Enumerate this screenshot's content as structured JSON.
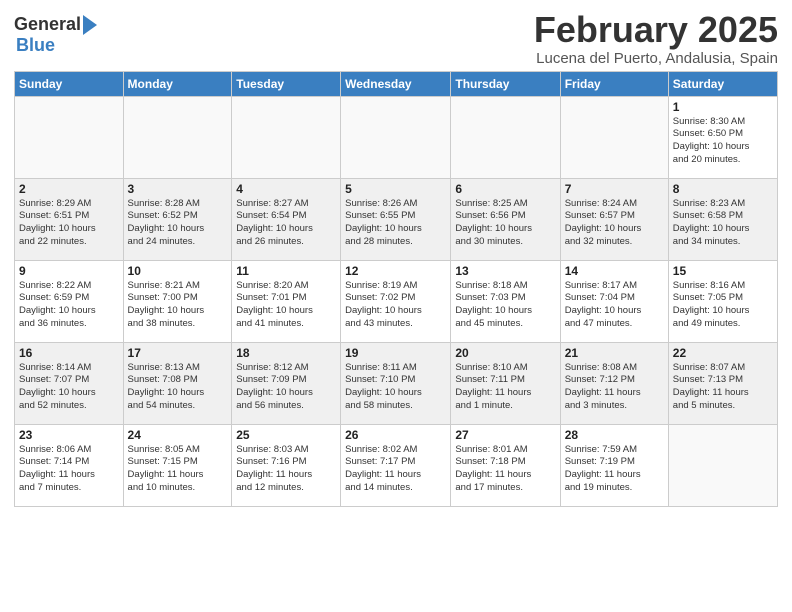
{
  "logo": {
    "general": "General",
    "blue": "Blue"
  },
  "title": "February 2025",
  "location": "Lucena del Puerto, Andalusia, Spain",
  "headers": [
    "Sunday",
    "Monday",
    "Tuesday",
    "Wednesday",
    "Thursday",
    "Friday",
    "Saturday"
  ],
  "weeks": [
    [
      {
        "day": "",
        "info": ""
      },
      {
        "day": "",
        "info": ""
      },
      {
        "day": "",
        "info": ""
      },
      {
        "day": "",
        "info": ""
      },
      {
        "day": "",
        "info": ""
      },
      {
        "day": "",
        "info": ""
      },
      {
        "day": "1",
        "info": "Sunrise: 8:30 AM\nSunset: 6:50 PM\nDaylight: 10 hours\nand 20 minutes."
      }
    ],
    [
      {
        "day": "2",
        "info": "Sunrise: 8:29 AM\nSunset: 6:51 PM\nDaylight: 10 hours\nand 22 minutes."
      },
      {
        "day": "3",
        "info": "Sunrise: 8:28 AM\nSunset: 6:52 PM\nDaylight: 10 hours\nand 24 minutes."
      },
      {
        "day": "4",
        "info": "Sunrise: 8:27 AM\nSunset: 6:54 PM\nDaylight: 10 hours\nand 26 minutes."
      },
      {
        "day": "5",
        "info": "Sunrise: 8:26 AM\nSunset: 6:55 PM\nDaylight: 10 hours\nand 28 minutes."
      },
      {
        "day": "6",
        "info": "Sunrise: 8:25 AM\nSunset: 6:56 PM\nDaylight: 10 hours\nand 30 minutes."
      },
      {
        "day": "7",
        "info": "Sunrise: 8:24 AM\nSunset: 6:57 PM\nDaylight: 10 hours\nand 32 minutes."
      },
      {
        "day": "8",
        "info": "Sunrise: 8:23 AM\nSunset: 6:58 PM\nDaylight: 10 hours\nand 34 minutes."
      }
    ],
    [
      {
        "day": "9",
        "info": "Sunrise: 8:22 AM\nSunset: 6:59 PM\nDaylight: 10 hours\nand 36 minutes."
      },
      {
        "day": "10",
        "info": "Sunrise: 8:21 AM\nSunset: 7:00 PM\nDaylight: 10 hours\nand 38 minutes."
      },
      {
        "day": "11",
        "info": "Sunrise: 8:20 AM\nSunset: 7:01 PM\nDaylight: 10 hours\nand 41 minutes."
      },
      {
        "day": "12",
        "info": "Sunrise: 8:19 AM\nSunset: 7:02 PM\nDaylight: 10 hours\nand 43 minutes."
      },
      {
        "day": "13",
        "info": "Sunrise: 8:18 AM\nSunset: 7:03 PM\nDaylight: 10 hours\nand 45 minutes."
      },
      {
        "day": "14",
        "info": "Sunrise: 8:17 AM\nSunset: 7:04 PM\nDaylight: 10 hours\nand 47 minutes."
      },
      {
        "day": "15",
        "info": "Sunrise: 8:16 AM\nSunset: 7:05 PM\nDaylight: 10 hours\nand 49 minutes."
      }
    ],
    [
      {
        "day": "16",
        "info": "Sunrise: 8:14 AM\nSunset: 7:07 PM\nDaylight: 10 hours\nand 52 minutes."
      },
      {
        "day": "17",
        "info": "Sunrise: 8:13 AM\nSunset: 7:08 PM\nDaylight: 10 hours\nand 54 minutes."
      },
      {
        "day": "18",
        "info": "Sunrise: 8:12 AM\nSunset: 7:09 PM\nDaylight: 10 hours\nand 56 minutes."
      },
      {
        "day": "19",
        "info": "Sunrise: 8:11 AM\nSunset: 7:10 PM\nDaylight: 10 hours\nand 58 minutes."
      },
      {
        "day": "20",
        "info": "Sunrise: 8:10 AM\nSunset: 7:11 PM\nDaylight: 11 hours\nand 1 minute."
      },
      {
        "day": "21",
        "info": "Sunrise: 8:08 AM\nSunset: 7:12 PM\nDaylight: 11 hours\nand 3 minutes."
      },
      {
        "day": "22",
        "info": "Sunrise: 8:07 AM\nSunset: 7:13 PM\nDaylight: 11 hours\nand 5 minutes."
      }
    ],
    [
      {
        "day": "23",
        "info": "Sunrise: 8:06 AM\nSunset: 7:14 PM\nDaylight: 11 hours\nand 7 minutes."
      },
      {
        "day": "24",
        "info": "Sunrise: 8:05 AM\nSunset: 7:15 PM\nDaylight: 11 hours\nand 10 minutes."
      },
      {
        "day": "25",
        "info": "Sunrise: 8:03 AM\nSunset: 7:16 PM\nDaylight: 11 hours\nand 12 minutes."
      },
      {
        "day": "26",
        "info": "Sunrise: 8:02 AM\nSunset: 7:17 PM\nDaylight: 11 hours\nand 14 minutes."
      },
      {
        "day": "27",
        "info": "Sunrise: 8:01 AM\nSunset: 7:18 PM\nDaylight: 11 hours\nand 17 minutes."
      },
      {
        "day": "28",
        "info": "Sunrise: 7:59 AM\nSunset: 7:19 PM\nDaylight: 11 hours\nand 19 minutes."
      },
      {
        "day": "",
        "info": ""
      }
    ]
  ]
}
